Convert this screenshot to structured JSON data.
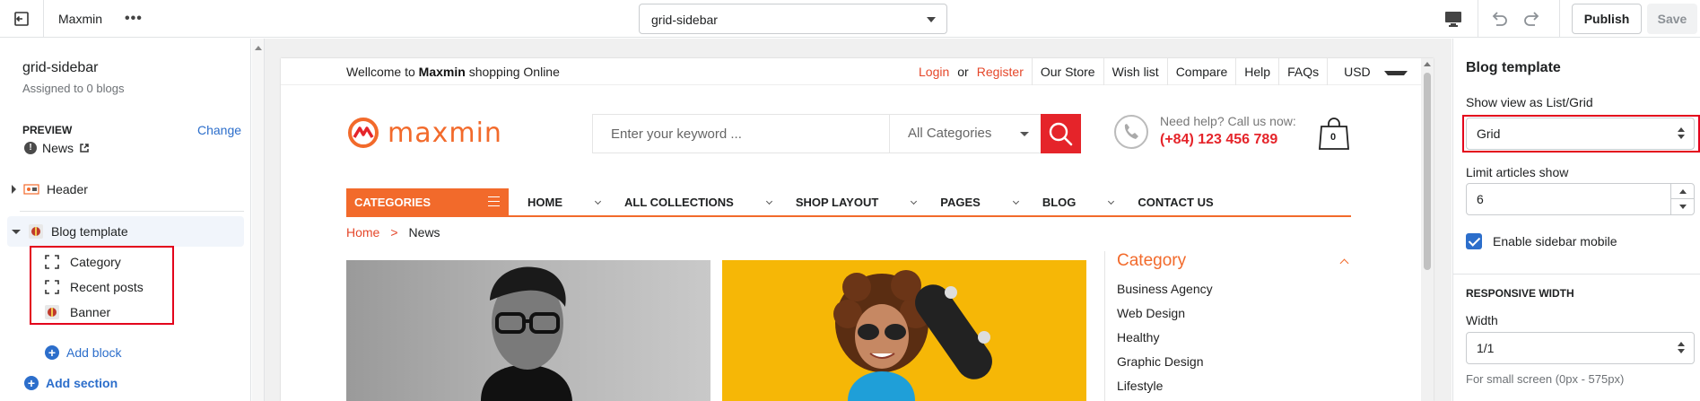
{
  "topbar": {
    "theme_name": "Maxmin",
    "more": "•••",
    "template_select": "grid-sidebar",
    "publish": "Publish",
    "save": "Save"
  },
  "left": {
    "template_title": "grid-sidebar",
    "template_sub": "Assigned to 0 blogs",
    "preview_label": "PREVIEW",
    "change": "Change",
    "preview_value": "News",
    "info_glyph": "!",
    "sections": [
      {
        "label": "Header"
      },
      {
        "label": "Blog template"
      }
    ],
    "blocks": [
      {
        "label": "Category",
        "icon": "dashed-frame-icon"
      },
      {
        "label": "Recent posts",
        "icon": "dashed-frame-icon"
      },
      {
        "label": "Banner",
        "icon": "banner-icon"
      }
    ],
    "add_block": "Add block",
    "add_section": "Add section",
    "plus_glyph": "+"
  },
  "site": {
    "welcome_pre": "Wellcome to",
    "welcome_brand": "Maxmin",
    "welcome_post": "shopping Online",
    "login": "Login",
    "or": "or",
    "register": "Register",
    "top_links": [
      "Our Store",
      "Wish list",
      "Compare",
      "Help",
      "FAQs"
    ],
    "currency": "USD",
    "logo_text": "maxmin",
    "search_placeholder": "Enter your keyword ...",
    "search_category": "All Categories",
    "help_line": "Need help? Call us now:",
    "phone": "(+84) 123 456 789",
    "cart_count": "0",
    "categories_btn": "CATEGORIES",
    "nav": [
      {
        "label": "HOME",
        "dropdown": true
      },
      {
        "label": "ALL COLLECTIONS",
        "dropdown": true
      },
      {
        "label": "SHOP LAYOUT",
        "dropdown": true
      },
      {
        "label": "PAGES",
        "dropdown": true
      },
      {
        "label": "BLOG",
        "dropdown": true
      },
      {
        "label": "CONTACT US",
        "dropdown": false
      }
    ],
    "breadcrumb": {
      "home": "Home",
      "sep": ">",
      "current": "News"
    },
    "category_widget": {
      "title": "Category",
      "items": [
        "Business Agency",
        "Web Design",
        "Healthy",
        "Graphic Design",
        "Lifestyle"
      ]
    }
  },
  "right": {
    "title": "Blog template",
    "view_label": "Show view as List/Grid",
    "view_value": "Grid",
    "limit_label": "Limit articles show",
    "limit_value": "6",
    "sidebar_mobile": "Enable sidebar mobile",
    "responsive_title": "RESPONSIVE WIDTH",
    "width_label": "Width",
    "width_value": "1/1",
    "width_help": "For small screen (0px - 575px)"
  },
  "colors": {
    "accent_blue": "#2c6ecb",
    "highlight_red": "#e3001b",
    "brand_orange": "#f26a2b",
    "brand_red": "#e5242a"
  }
}
